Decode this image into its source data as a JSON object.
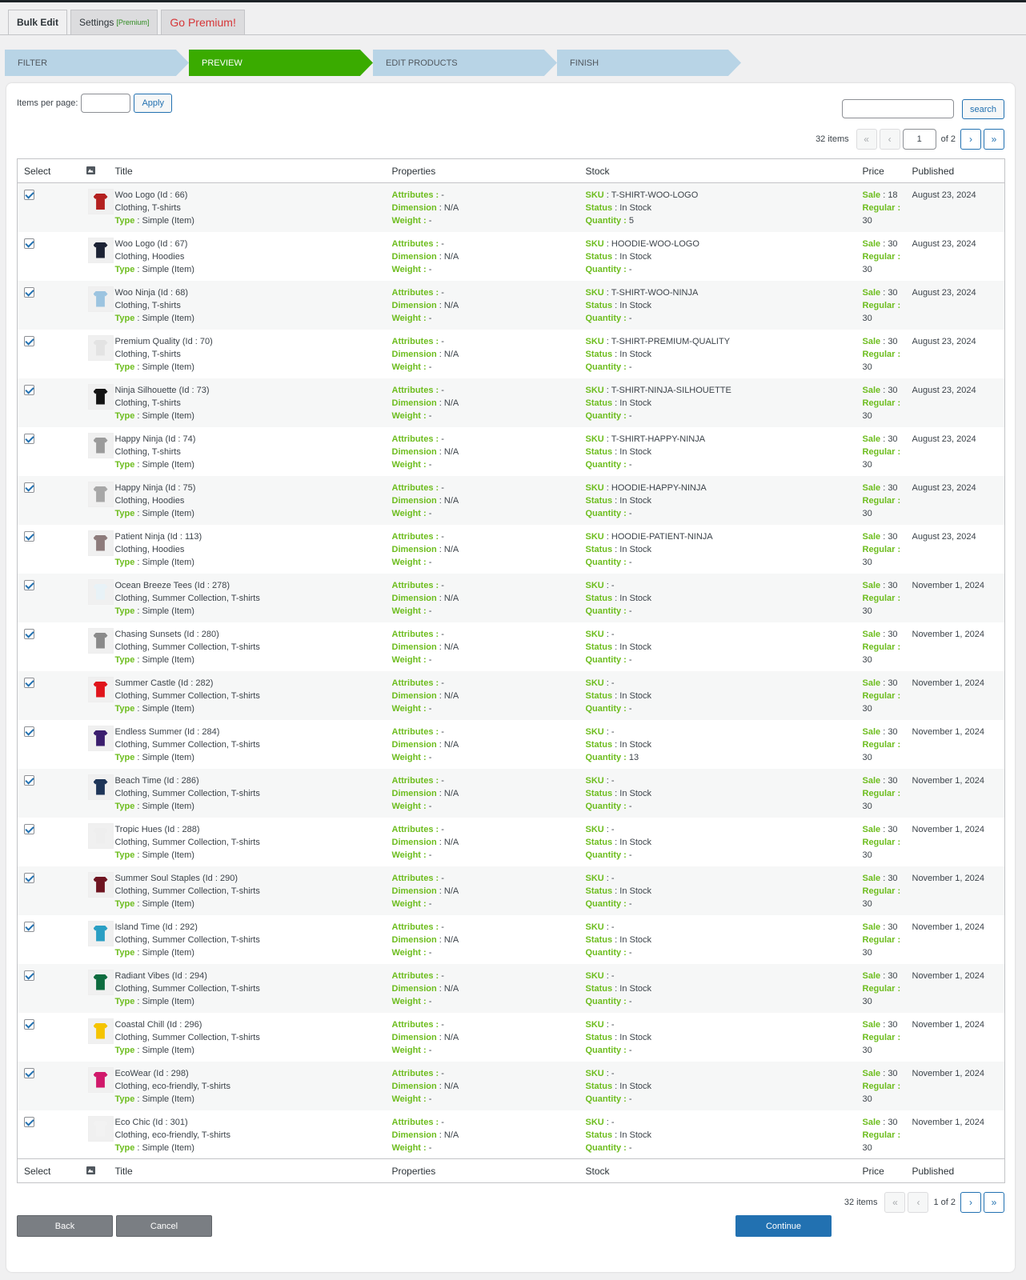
{
  "tabs": [
    {
      "label": "Bulk Edit"
    },
    {
      "label": "Settings",
      "badge": "[Premium]"
    },
    {
      "label": "Go Premium!"
    }
  ],
  "steps": [
    "FILTER",
    "PREVIEW",
    "EDIT PRODUCTS",
    "FINISH"
  ],
  "controls": {
    "items_per_page_label": "Items per page:",
    "apply": "Apply",
    "search": "search",
    "items_count": "32 items",
    "page_value": "1",
    "of_pages": "of 2",
    "bottom_page": "1 of 2"
  },
  "columns": {
    "select": "Select",
    "title": "Title",
    "properties": "Properties",
    "stock": "Stock",
    "price": "Price",
    "published": "Published"
  },
  "labels": {
    "id_prefix": "(Id : ",
    "type": "Type",
    "type_value": "Simple (Item)",
    "attributes": "Attributes",
    "dimension": "Dimension",
    "weight": "Weight",
    "sku": "SKU",
    "status": "Status",
    "quantity": "Quantity",
    "sale": "Sale",
    "regular": "Regular"
  },
  "rows": [
    {
      "name": "Woo Logo",
      "id": "66",
      "cats": "Clothing, T-shirts",
      "sku": "T-SHIRT-WOO-LOGO",
      "status": "In Stock",
      "qty": "5",
      "sale": "18",
      "regular": "30",
      "published": "August 23, 2024",
      "color": "#b3201f"
    },
    {
      "name": "Woo Logo",
      "id": "67",
      "cats": "Clothing, Hoodies",
      "sku": "HOODIE-WOO-LOGO",
      "status": "In Stock",
      "qty": "-",
      "sale": "30",
      "regular": "30",
      "published": "August 23, 2024",
      "color": "#1c2234"
    },
    {
      "name": "Woo Ninja",
      "id": "68",
      "cats": "Clothing, T-shirts",
      "sku": "T-SHIRT-WOO-NINJA",
      "status": "In Stock",
      "qty": "-",
      "sale": "30",
      "regular": "30",
      "published": "August 23, 2024",
      "color": "#9cc4e0"
    },
    {
      "name": "Premium Quality",
      "id": "70",
      "cats": "Clothing, T-shirts",
      "sku": "T-SHIRT-PREMIUM-QUALITY",
      "status": "In Stock",
      "qty": "-",
      "sale": "30",
      "regular": "30",
      "published": "August 23, 2024",
      "color": "#e3e3e3"
    },
    {
      "name": "Ninja Silhouette",
      "id": "73",
      "cats": "Clothing, T-shirts",
      "sku": "T-SHIRT-NINJA-SILHOUETTE",
      "status": "In Stock",
      "qty": "-",
      "sale": "30",
      "regular": "30",
      "published": "August 23, 2024",
      "color": "#141414"
    },
    {
      "name": "Happy Ninja",
      "id": "74",
      "cats": "Clothing, T-shirts",
      "sku": "T-SHIRT-HAPPY-NINJA",
      "status": "In Stock",
      "qty": "-",
      "sale": "30",
      "regular": "30",
      "published": "August 23, 2024",
      "color": "#9b9b9b"
    },
    {
      "name": "Happy Ninja",
      "id": "75",
      "cats": "Clothing, Hoodies",
      "sku": "HOODIE-HAPPY-NINJA",
      "status": "In Stock",
      "qty": "-",
      "sale": "30",
      "regular": "30",
      "published": "August 23, 2024",
      "color": "#a7a7a7"
    },
    {
      "name": "Patient Ninja",
      "id": "113",
      "cats": "Clothing, Hoodies",
      "sku": "HOODIE-PATIENT-NINJA",
      "status": "In Stock",
      "qty": "-",
      "sale": "30",
      "regular": "30",
      "published": "August 23, 2024",
      "color": "#8d7b7b"
    },
    {
      "name": "Ocean Breeze Tees",
      "id": "278",
      "cats": "Clothing, Summer Collection, T-shirts",
      "sku": "-",
      "status": "In Stock",
      "qty": "-",
      "sale": "30",
      "regular": "30",
      "published": "November 1, 2024",
      "color": "#e8f2f7"
    },
    {
      "name": "Chasing Sunsets",
      "id": "280",
      "cats": "Clothing, Summer Collection, T-shirts",
      "sku": "-",
      "status": "In Stock",
      "qty": "-",
      "sale": "30",
      "regular": "30",
      "published": "November 1, 2024",
      "color": "#8a8a8a"
    },
    {
      "name": "Summer Castle",
      "id": "282",
      "cats": "Clothing, Summer Collection, T-shirts",
      "sku": "-",
      "status": "In Stock",
      "qty": "-",
      "sale": "30",
      "regular": "30",
      "published": "November 1, 2024",
      "color": "#e0141b"
    },
    {
      "name": "Endless Summer",
      "id": "284",
      "cats": "Clothing, Summer Collection, T-shirts",
      "sku": "-",
      "status": "In Stock",
      "qty": "13",
      "sale": "30",
      "regular": "30",
      "published": "November 1, 2024",
      "color": "#3b1e6e"
    },
    {
      "name": "Beach Time",
      "id": "286",
      "cats": "Clothing, Summer Collection, T-shirts",
      "sku": "-",
      "status": "In Stock",
      "qty": "-",
      "sale": "30",
      "regular": "30",
      "published": "November 1, 2024",
      "color": "#1e3558"
    },
    {
      "name": "Tropic Hues",
      "id": "288",
      "cats": "Clothing, Summer Collection, T-shirts",
      "sku": "-",
      "status": "In Stock",
      "qty": "-",
      "sale": "30",
      "regular": "30",
      "published": "November 1, 2024",
      "color": "#eeeeee"
    },
    {
      "name": "Summer Soul Staples",
      "id": "290",
      "cats": "Clothing, Summer Collection, T-shirts",
      "sku": "-",
      "status": "In Stock",
      "qty": "-",
      "sale": "30",
      "regular": "30",
      "published": "November 1, 2024",
      "color": "#6e1420"
    },
    {
      "name": "Island Time",
      "id": "292",
      "cats": "Clothing, Summer Collection, T-shirts",
      "sku": "-",
      "status": "In Stock",
      "qty": "-",
      "sale": "30",
      "regular": "30",
      "published": "November 1, 2024",
      "color": "#2a9fc4"
    },
    {
      "name": "Radiant Vibes",
      "id": "294",
      "cats": "Clothing, Summer Collection, T-shirts",
      "sku": "-",
      "status": "In Stock",
      "qty": "-",
      "sale": "30",
      "regular": "30",
      "published": "November 1, 2024",
      "color": "#0d6b3e"
    },
    {
      "name": "Coastal Chill",
      "id": "296",
      "cats": "Clothing, Summer Collection, T-shirts",
      "sku": "-",
      "status": "In Stock",
      "qty": "-",
      "sale": "30",
      "regular": "30",
      "published": "November 1, 2024",
      "color": "#f5c400"
    },
    {
      "name": "EcoWear",
      "id": "298",
      "cats": "Clothing, eco-friendly, T-shirts",
      "sku": "-",
      "status": "In Stock",
      "qty": "-",
      "sale": "30",
      "regular": "30",
      "published": "November 1, 2024",
      "color": "#d0186a"
    },
    {
      "name": "Eco Chic",
      "id": "301",
      "cats": "Clothing, eco-friendly, T-shirts",
      "sku": "-",
      "status": "In Stock",
      "qty": "-",
      "sale": "30",
      "regular": "30",
      "published": "November 1, 2024",
      "color": "#f2f2f2"
    }
  ],
  "buttons": {
    "back": "Back",
    "cancel": "Cancel",
    "continue": "Continue"
  }
}
